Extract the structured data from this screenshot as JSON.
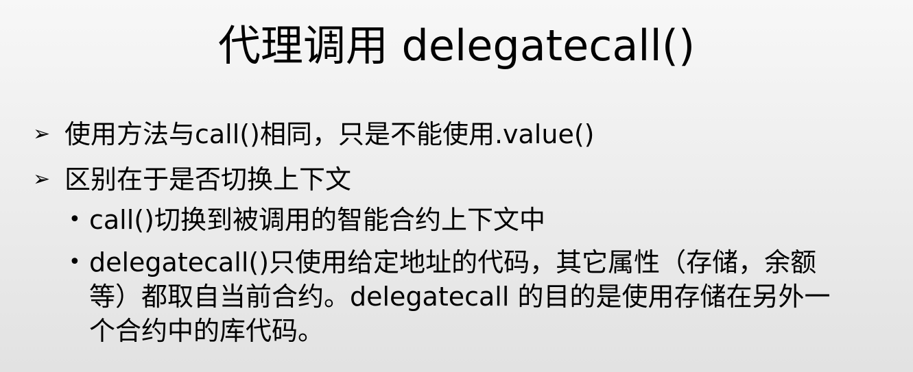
{
  "slide": {
    "title": "代理调用 delegatecall()",
    "bullets": [
      {
        "marker": "➢",
        "text": "使用方法与call()相同，只是不能使用.value()"
      },
      {
        "marker": "➢",
        "text": "区别在于是否切换上下文",
        "sub_bullets": [
          {
            "marker": "•",
            "text": "call()切换到被调用的智能合约上下文中"
          },
          {
            "marker": "•",
            "line1": "delegatecall()只使用给定地址的代码，其它属性（存储，余额",
            "line2": "等）都取自当前合约。delegatecall 的目的是使用存储在另外一",
            "line3": "个合约中的库代码。"
          }
        ]
      }
    ]
  }
}
